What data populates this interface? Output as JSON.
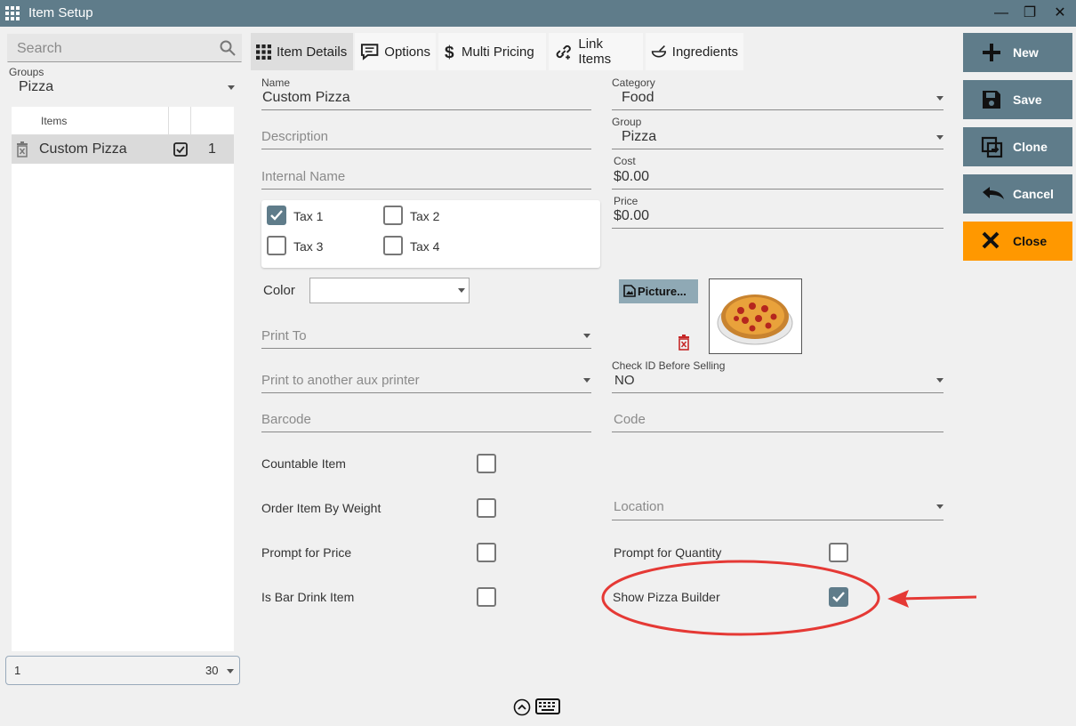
{
  "window": {
    "title": "Item Setup",
    "minimize_glyph": "—",
    "restore_glyph": "❐",
    "close_glyph": "✕"
  },
  "left": {
    "search_placeholder": "Search",
    "groups_label": "Groups",
    "groups_value": "Pizza",
    "items_header": "Items",
    "rows": [
      {
        "name": "Custom Pizza",
        "checked": true,
        "count": "1"
      }
    ],
    "pager_page": "1",
    "pager_size": "30"
  },
  "tabs": [
    {
      "label": "Item Details",
      "icon": "grid-icon",
      "active": true
    },
    {
      "label": "Options",
      "icon": "chat-icon",
      "active": false
    },
    {
      "label": "Multi Pricing",
      "icon": "dollar-icon",
      "active": false
    },
    {
      "label": "Link Items",
      "icon": "link-icon",
      "active": false
    },
    {
      "label": "Ingredients",
      "icon": "bowl-icon",
      "active": false
    }
  ],
  "actions": {
    "new": "New",
    "save": "Save",
    "clone": "Clone",
    "cancel": "Cancel",
    "close": "Close"
  },
  "form": {
    "name_label": "Name",
    "name_value": "Custom Pizza",
    "description_placeholder": "Description",
    "internal_name_placeholder": "Internal Name",
    "taxes": [
      {
        "label": "Tax 1",
        "checked": true
      },
      {
        "label": "Tax 2",
        "checked": false
      },
      {
        "label": "Tax 3",
        "checked": false
      },
      {
        "label": "Tax 4",
        "checked": false
      }
    ],
    "color_label": "Color",
    "print_to_placeholder": "Print To",
    "aux_printer_placeholder": "Print to another aux printer",
    "barcode_placeholder": "Barcode",
    "category_label": "Category",
    "category_value": "Food",
    "group_label": "Group",
    "group_value": "Pizza",
    "cost_label": "Cost",
    "cost_value": "$0.00",
    "price_label": "Price",
    "price_value": "$0.00",
    "picture_button": "Picture...",
    "check_id_label": "Check ID Before Selling",
    "check_id_value": "NO",
    "code_placeholder": "Code",
    "location_placeholder": "Location",
    "countable_item": "Countable Item",
    "order_by_weight": "Order Item By Weight",
    "prompt_price": "Prompt for Price",
    "bar_drink": "Is Bar Drink Item",
    "prompt_quantity": "Prompt for Quantity",
    "show_pizza_builder": "Show Pizza Builder",
    "show_pizza_builder_checked": true
  },
  "colors": {
    "accent": "#5f7c8a",
    "close": "#ff9800",
    "annotation": "#e53935"
  }
}
